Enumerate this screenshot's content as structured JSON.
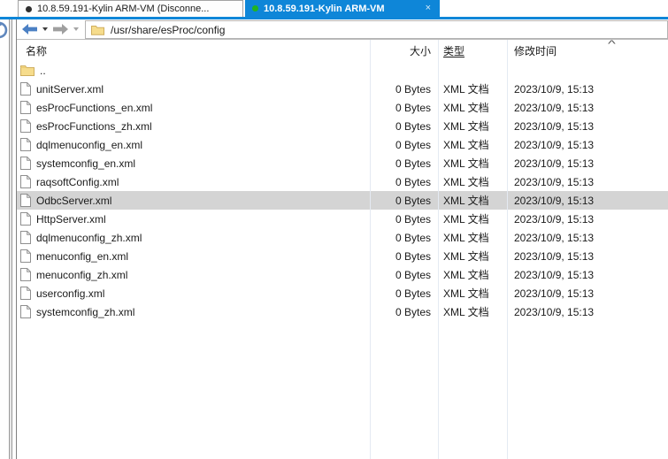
{
  "tabs": [
    {
      "label": "10.8.59.191-Kylin ARM-VM (Disconne...",
      "status": "disconnected"
    },
    {
      "label": "10.8.59.191-Kylin ARM-VM",
      "status": "connected",
      "close_icon": "×"
    }
  ],
  "toolbar": {
    "path": "/usr/share/esProc/config"
  },
  "file_list": {
    "columns": {
      "name": "名称",
      "size": "大小",
      "type": "类型",
      "mtime": "修改时间"
    },
    "scroll_up_hint": "^",
    "rows": [
      {
        "name": "..",
        "icon": "folder",
        "size": "",
        "type": "",
        "mtime": "",
        "selected": false
      },
      {
        "name": "unitServer.xml",
        "icon": "file",
        "size": "0 Bytes",
        "type": "XML 文档",
        "mtime": "2023/10/9, 15:13",
        "selected": false
      },
      {
        "name": "esProcFunctions_en.xml",
        "icon": "file",
        "size": "0 Bytes",
        "type": "XML 文档",
        "mtime": "2023/10/9, 15:13",
        "selected": false
      },
      {
        "name": "esProcFunctions_zh.xml",
        "icon": "file",
        "size": "0 Bytes",
        "type": "XML 文档",
        "mtime": "2023/10/9, 15:13",
        "selected": false
      },
      {
        "name": "dqlmenuconfig_en.xml",
        "icon": "file",
        "size": "0 Bytes",
        "type": "XML 文档",
        "mtime": "2023/10/9, 15:13",
        "selected": false
      },
      {
        "name": "systemconfig_en.xml",
        "icon": "file",
        "size": "0 Bytes",
        "type": "XML 文档",
        "mtime": "2023/10/9, 15:13",
        "selected": false
      },
      {
        "name": "raqsoftConfig.xml",
        "icon": "file",
        "size": "0 Bytes",
        "type": "XML 文档",
        "mtime": "2023/10/9, 15:13",
        "selected": false
      },
      {
        "name": "OdbcServer.xml",
        "icon": "file",
        "size": "0 Bytes",
        "type": "XML 文档",
        "mtime": "2023/10/9, 15:13",
        "selected": true
      },
      {
        "name": "HttpServer.xml",
        "icon": "file",
        "size": "0 Bytes",
        "type": "XML 文档",
        "mtime": "2023/10/9, 15:13",
        "selected": false
      },
      {
        "name": "dqlmenuconfig_zh.xml",
        "icon": "file",
        "size": "0 Bytes",
        "type": "XML 文档",
        "mtime": "2023/10/9, 15:13",
        "selected": false
      },
      {
        "name": "menuconfig_en.xml",
        "icon": "file",
        "size": "0 Bytes",
        "type": "XML 文档",
        "mtime": "2023/10/9, 15:13",
        "selected": false
      },
      {
        "name": "menuconfig_zh.xml",
        "icon": "file",
        "size": "0 Bytes",
        "type": "XML 文档",
        "mtime": "2023/10/9, 15:13",
        "selected": false
      },
      {
        "name": "userconfig.xml",
        "icon": "file",
        "size": "0 Bytes",
        "type": "XML 文档",
        "mtime": "2023/10/9, 15:13",
        "selected": false
      },
      {
        "name": "systemconfig_zh.xml",
        "icon": "file",
        "size": "0 Bytes",
        "type": "XML 文档",
        "mtime": "2023/10/9, 15:13",
        "selected": false
      }
    ]
  },
  "colors": {
    "active_tab": "#0e86d8",
    "connected_dot": "#21b421",
    "disconnected_dot": "#2f2f2f",
    "selected_row": "#d4d4d4",
    "back_arrow": "#4b80c4",
    "forward_arrow": "#9f9f9f",
    "folder_icon": "#f6dc8c"
  }
}
